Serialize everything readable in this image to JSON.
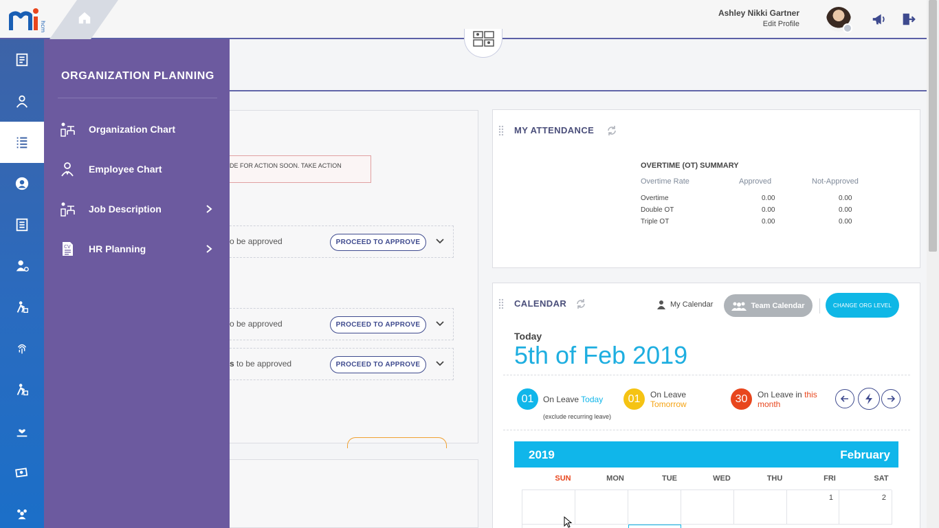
{
  "header": {
    "user_name": "Ashley Nikki Gartner",
    "edit_profile": "Edit Profile"
  },
  "flyout": {
    "title": "ORGANIZATION PLANNING",
    "items": [
      {
        "label": "Organization Chart",
        "icon": "org-chart-icon",
        "has_submenu": false
      },
      {
        "label": "Employee Chart",
        "icon": "employee-icon",
        "has_submenu": false
      },
      {
        "label": "Job Description",
        "icon": "job-description-icon",
        "has_submenu": true
      },
      {
        "label": "HR Planning",
        "icon": "cv-document-icon",
        "has_submenu": true
      }
    ]
  },
  "tasks": {
    "alert_text": "DE FOR ACTION SOON. TAKE ACTION",
    "rows": [
      {
        "text_pre": "",
        "text_bold": "",
        "text_post": "o be approved",
        "button": "PROCEED TO APPROVE"
      },
      {
        "text_pre": "",
        "text_bold": "",
        "text_post": "o be approved",
        "button": "PROCEED TO APPROVE"
      },
      {
        "text_pre": "",
        "text_bold": "s",
        "text_post": " to be approved",
        "button": "PROCEED TO APPROVE"
      }
    ]
  },
  "attendance": {
    "title": "MY ATTENDANCE",
    "ot_title": "OVERTIME (OT) SUMMARY",
    "columns": [
      "Overtime Rate",
      "Approved",
      "Not-Approved"
    ],
    "rows": [
      {
        "rate": "Overtime",
        "approved": "0.00",
        "not_approved": "0.00"
      },
      {
        "rate": "Double OT",
        "approved": "0.00",
        "not_approved": "0.00"
      },
      {
        "rate": "Triple OT",
        "approved": "0.00",
        "not_approved": "0.00"
      }
    ]
  },
  "calendar": {
    "title": "CALENDAR",
    "my_calendar": "My Calendar",
    "team_calendar": "Team Calendar",
    "change_org": "CHANGE ORG LEVEL",
    "today_label": "Today",
    "today_date": "5th of Feb 2019",
    "leave_today": {
      "count": "01",
      "text": "On Leave",
      "highlight": "Today",
      "sub": "(exclude recurring leave)"
    },
    "leave_tomorrow": {
      "count": "01",
      "text": "On Leave",
      "highlight": "Tomorrow"
    },
    "leave_month": {
      "count": "30",
      "text": "On Leave in",
      "highlight1": "this",
      "highlight2": "month"
    },
    "year": "2019",
    "month": "February",
    "days": [
      "SUN",
      "MON",
      "TUE",
      "WED",
      "THU",
      "FRI",
      "SAT"
    ],
    "first_week": [
      "",
      "",
      "",
      "",
      "",
      "1",
      "2"
    ],
    "colors": {
      "cyan": "#10b6ea",
      "yellow": "#f5c313",
      "red": "#e8461d",
      "accent": "#3e4a8e",
      "menu": "#6c5a9f"
    }
  }
}
